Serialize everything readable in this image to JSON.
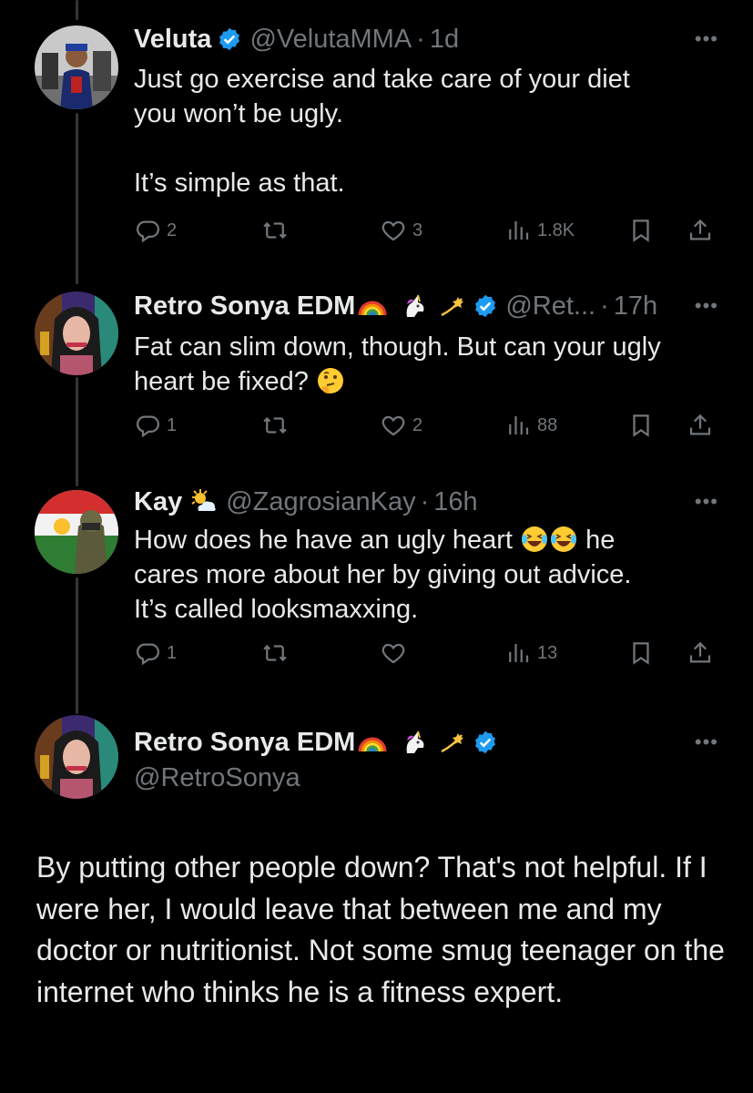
{
  "tweets": [
    {
      "author": "Veluta",
      "handle": "@VelutaMMA",
      "time": "1d",
      "text": [
        "Just go exercise and take care of your diet",
        "you won’t be ugly.",
        "",
        "It’s simple as that."
      ],
      "replies": "2",
      "retweets": "",
      "likes": "3",
      "views": "1.8K"
    },
    {
      "author": "Retro Sonya EDM",
      "handle": "@Ret...",
      "time": "17h",
      "text": [
        "Fat can slim down, though. But can your ugly",
        "heart be fixed?"
      ],
      "replies": "1",
      "retweets": "",
      "likes": "2",
      "views": "88"
    },
    {
      "author": "Kay",
      "handle": "@ZagrosianKay",
      "time": "16h",
      "text": [
        "How does he have an ugly heart",
        "he",
        "cares more about her by giving out advice.",
        "It’s called looksmaxxing."
      ],
      "replies": "1",
      "retweets": "",
      "likes": "",
      "views": "13"
    }
  ],
  "main_tweet": {
    "author": "Retro Sonya EDM",
    "handle": "@RetroSonya",
    "text": "By putting other people down? That's not helpful. If I were her, I would leave that between me and my doctor or nutritionist. Not some smug teenager on the internet who thinks he is a fitness expert."
  },
  "separator": "·",
  "more_label": "•••",
  "colors": {
    "background": "#000000",
    "text": "#e7e9ea",
    "muted": "#71767b",
    "verified": "#1d9bf0",
    "thread_line": "#333639"
  },
  "icons": [
    "reply-icon",
    "retweet-icon",
    "like-icon",
    "views-icon",
    "bookmark-icon",
    "share-icon",
    "verified-icon",
    "rainbow-emoji",
    "unicorn-emoji",
    "dizzy-emoji",
    "thinking-emoji",
    "sun-cloud-emoji",
    "laughing-emoji"
  ]
}
